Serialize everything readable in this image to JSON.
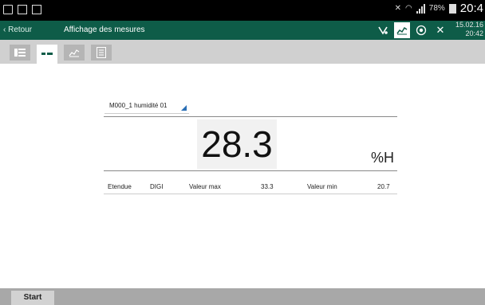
{
  "status_bar": {
    "battery_text": "78%",
    "time": "20:4"
  },
  "header": {
    "back_label": "‹ Retour",
    "title": "Affichage des mesures",
    "date": "15.02.16",
    "time": "20:42",
    "icons": [
      "signal-check-icon",
      "chart-icon",
      "record-icon",
      "tools-icon"
    ]
  },
  "tabs": [
    {
      "name": "list-view",
      "active": false
    },
    {
      "name": "digital-view",
      "active": true
    },
    {
      "name": "chart-view",
      "active": false
    },
    {
      "name": "report-view",
      "active": false
    }
  ],
  "measurement": {
    "channel": "M000_1 humidité 01",
    "value": "28.3",
    "unit": "%H",
    "range_label": "Etendue",
    "range_value": "DIGI",
    "max_label": "Valeur max",
    "max_value": "33.3",
    "min_label": "Valeur min",
    "min_value": "20.7"
  },
  "footer": {
    "start_label": "Start"
  }
}
